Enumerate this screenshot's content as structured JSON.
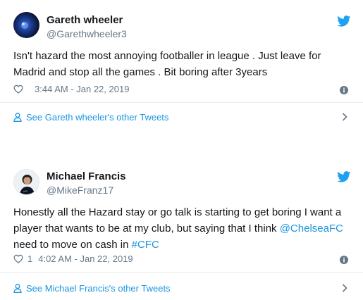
{
  "tweets": [
    {
      "name": "Gareth wheeler",
      "handle": "@Garethwheeler3",
      "text": "Isn't hazard the most annoying footballer in league . Just leave for Madrid and stop all the games . Bit boring after 3years",
      "like_count": "",
      "timestamp": "3:44 AM - Jan 22, 2019",
      "other_tweets": "See Gareth wheeler's other Tweets"
    },
    {
      "name": "Michael Francis",
      "handle": "@MikeFranz17",
      "text_parts": {
        "line_a": "Honestly all the Hazard stay or go talk is starting to get boring I want a player that wants to be at my club, but saying that I think ",
        "mention": "@ChelseaFC",
        "middle": " need to move on cash in  ",
        "hashtag": "#CFC"
      },
      "like_count": "1",
      "timestamp": "4:02 AM - Jan 22, 2019",
      "other_tweets": "See Michael Francis's other Tweets"
    }
  ],
  "colors": {
    "link": "#1b95e0",
    "secondary": "#657786",
    "text": "#14171a",
    "divider": "#e6ecf0",
    "bird": "#1da1f2"
  },
  "icons": [
    "twitter-bird-icon",
    "heart-icon",
    "info-icon",
    "person-icon",
    "chevron-right-icon"
  ]
}
